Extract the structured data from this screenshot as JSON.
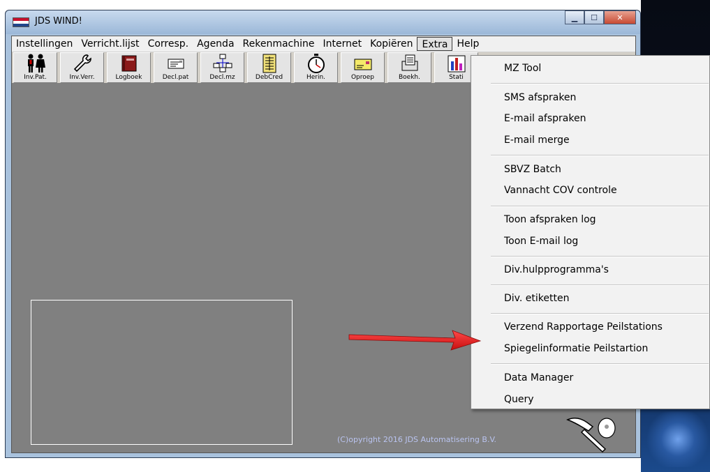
{
  "window": {
    "title": "JDS WIND!"
  },
  "menubar": {
    "items": [
      "Instellingen",
      "Verricht.lijst",
      "Corresp.",
      "Agenda",
      "Rekenmachine",
      "Internet",
      "Kopiëren",
      "Extra",
      "Help"
    ],
    "active": "Extra"
  },
  "toolbar": {
    "buttons": [
      {
        "label": "Inv.Pat.",
        "icon": "people-icon"
      },
      {
        "label": "Inv.Verr.",
        "icon": "wrench-icon"
      },
      {
        "label": "Logboek",
        "icon": "book-icon"
      },
      {
        "label": "Decl.pat",
        "icon": "document-icon"
      },
      {
        "label": "Decl.mz",
        "icon": "network-icon"
      },
      {
        "label": "DebCred",
        "icon": "ledger-icon"
      },
      {
        "label": "Herin.",
        "icon": "stopwatch-icon"
      },
      {
        "label": "Oproep",
        "icon": "envelope-icon"
      },
      {
        "label": "Boekh.",
        "icon": "folder-icon"
      },
      {
        "label": "Stati",
        "icon": "chart-icon"
      }
    ]
  },
  "dropdown": {
    "items": [
      "MZ Tool",
      "SMS afspraken",
      "E-mail afspraken",
      "E-mail merge",
      "SBVZ Batch",
      "Vannacht COV controle",
      "Toon afspraken log",
      "Toon E-mail log",
      "Div.hulpprogramma's",
      "Div. etiketten",
      "Verzend Rapportage Peilstations",
      "Spiegelinformatie Peilstartion",
      "Data Manager",
      "Query"
    ]
  },
  "footer": {
    "copyright": "(C)opyright 2016 JDS Automatisering B.V."
  },
  "colors": {
    "workspace": "#808080",
    "menu_bg": "#f2f2f2",
    "arrow": "#e01818",
    "copyright_text": "#b9c3ef"
  }
}
